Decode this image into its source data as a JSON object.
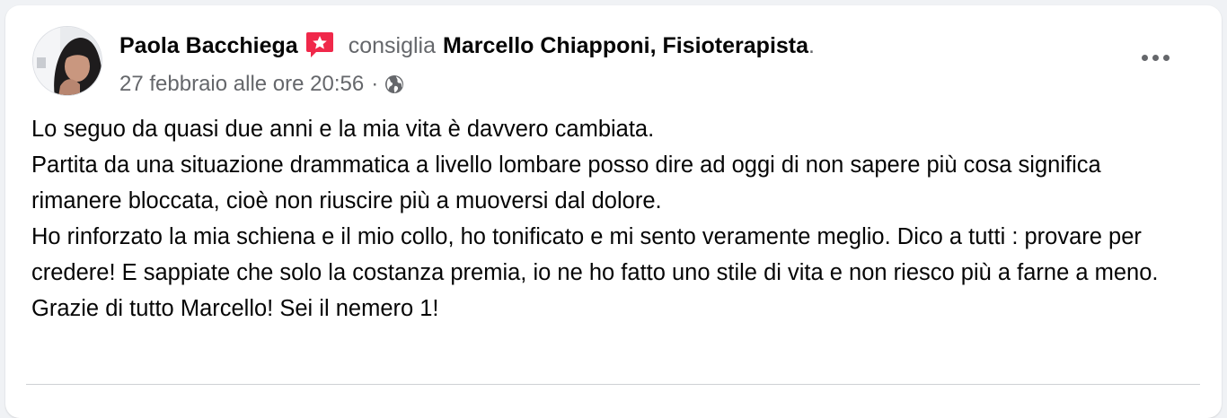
{
  "post": {
    "author_name": "Paola Bacchiega",
    "action_verb": "consiglia",
    "recommended_page": "Marcello Chiapponi, Fisioterapista",
    "trailing_period": ".",
    "timestamp": "27 febbraio alle ore 20:56",
    "separator": "·",
    "privacy_icon": "globe-icon",
    "more_icon": "more-options-icon",
    "recommendation_badge_icon": "recommend-star-icon",
    "body_lines": [
      "Lo seguo da quasi due anni e la mia vita è davvero cambiata.",
      "Partita da una situazione drammatica a livello lombare posso dire ad oggi di non sapere più cosa significa rimanere bloccata, cioè non riuscire più a muoversi dal dolore.",
      "Ho rinforzato la mia schiena e il mio collo, ho tonificato e mi sento veramente meglio. Dico a tutti : provare per credere! E sappiate che solo la costanza premia, io ne ho fatto uno stile di vita e non riesco più a farne a meno.",
      "Grazie di tutto Marcello! Sei il nemero 1!"
    ]
  },
  "colors": {
    "badge_red": "#f0284a",
    "secondary_text": "#65676b",
    "primary_text": "#050505"
  }
}
